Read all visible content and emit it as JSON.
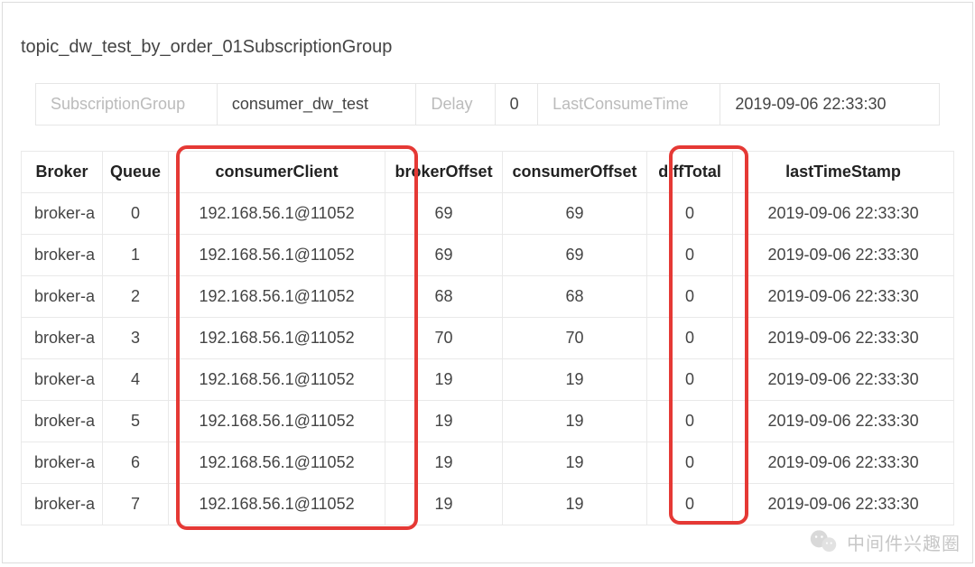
{
  "title": "topic_dw_test_by_order_01SubscriptionGroup",
  "info": {
    "subscription_group_label": "SubscriptionGroup",
    "subscription_group_value": "consumer_dw_test",
    "delay_label": "Delay",
    "delay_value": "0",
    "last_consume_time_label": "LastConsumeTime",
    "last_consume_time_value": "2019-09-06 22:33:30"
  },
  "columns": {
    "broker": "Broker",
    "queue": "Queue",
    "consumer_client": "consumerClient",
    "broker_offset": "brokerOffset",
    "consumer_offset": "consumerOffset",
    "diff_total": "diffTotal",
    "last_timestamp": "lastTimeStamp"
  },
  "rows": [
    {
      "broker": "broker-a",
      "queue": "0",
      "consumer_client": "192.168.56.1@11052",
      "broker_offset": "69",
      "consumer_offset": "69",
      "diff_total": "0",
      "last_timestamp": "2019-09-06 22:33:30"
    },
    {
      "broker": "broker-a",
      "queue": "1",
      "consumer_client": "192.168.56.1@11052",
      "broker_offset": "69",
      "consumer_offset": "69",
      "diff_total": "0",
      "last_timestamp": "2019-09-06 22:33:30"
    },
    {
      "broker": "broker-a",
      "queue": "2",
      "consumer_client": "192.168.56.1@11052",
      "broker_offset": "68",
      "consumer_offset": "68",
      "diff_total": "0",
      "last_timestamp": "2019-09-06 22:33:30"
    },
    {
      "broker": "broker-a",
      "queue": "3",
      "consumer_client": "192.168.56.1@11052",
      "broker_offset": "70",
      "consumer_offset": "70",
      "diff_total": "0",
      "last_timestamp": "2019-09-06 22:33:30"
    },
    {
      "broker": "broker-a",
      "queue": "4",
      "consumer_client": "192.168.56.1@11052",
      "broker_offset": "19",
      "consumer_offset": "19",
      "diff_total": "0",
      "last_timestamp": "2019-09-06 22:33:30"
    },
    {
      "broker": "broker-a",
      "queue": "5",
      "consumer_client": "192.168.56.1@11052",
      "broker_offset": "19",
      "consumer_offset": "19",
      "diff_total": "0",
      "last_timestamp": "2019-09-06 22:33:30"
    },
    {
      "broker": "broker-a",
      "queue": "6",
      "consumer_client": "192.168.56.1@11052",
      "broker_offset": "19",
      "consumer_offset": "19",
      "diff_total": "0",
      "last_timestamp": "2019-09-06 22:33:30"
    },
    {
      "broker": "broker-a",
      "queue": "7",
      "consumer_client": "192.168.56.1@11052",
      "broker_offset": "19",
      "consumer_offset": "19",
      "diff_total": "0",
      "last_timestamp": "2019-09-06 22:33:30"
    }
  ],
  "watermark": {
    "text": "中间件兴趣圈"
  }
}
